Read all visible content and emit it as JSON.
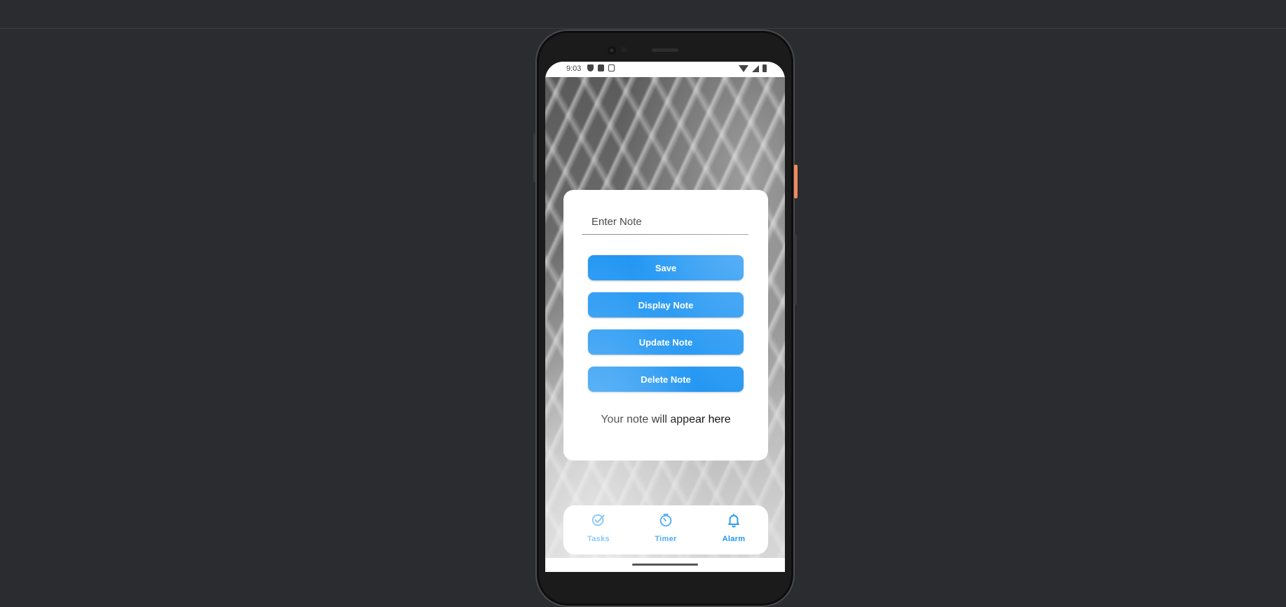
{
  "status_bar": {
    "time": "9:03"
  },
  "note_form": {
    "input_placeholder": "Enter Note",
    "input_value": "",
    "save_label": "Save",
    "display_label": "Display Note",
    "update_label": "Update Note",
    "delete_label": "Delete Note",
    "output_text": "Your note will appear here"
  },
  "bottom_nav": {
    "items": [
      {
        "label": "Tasks",
        "icon": "check-circle-icon"
      },
      {
        "label": "Timer",
        "icon": "timer-icon"
      },
      {
        "label": "Alarm",
        "icon": "bell-icon"
      }
    ]
  },
  "colors": {
    "accent": "#2196f3",
    "background": "#2b2c30",
    "card": "#ffffff"
  }
}
